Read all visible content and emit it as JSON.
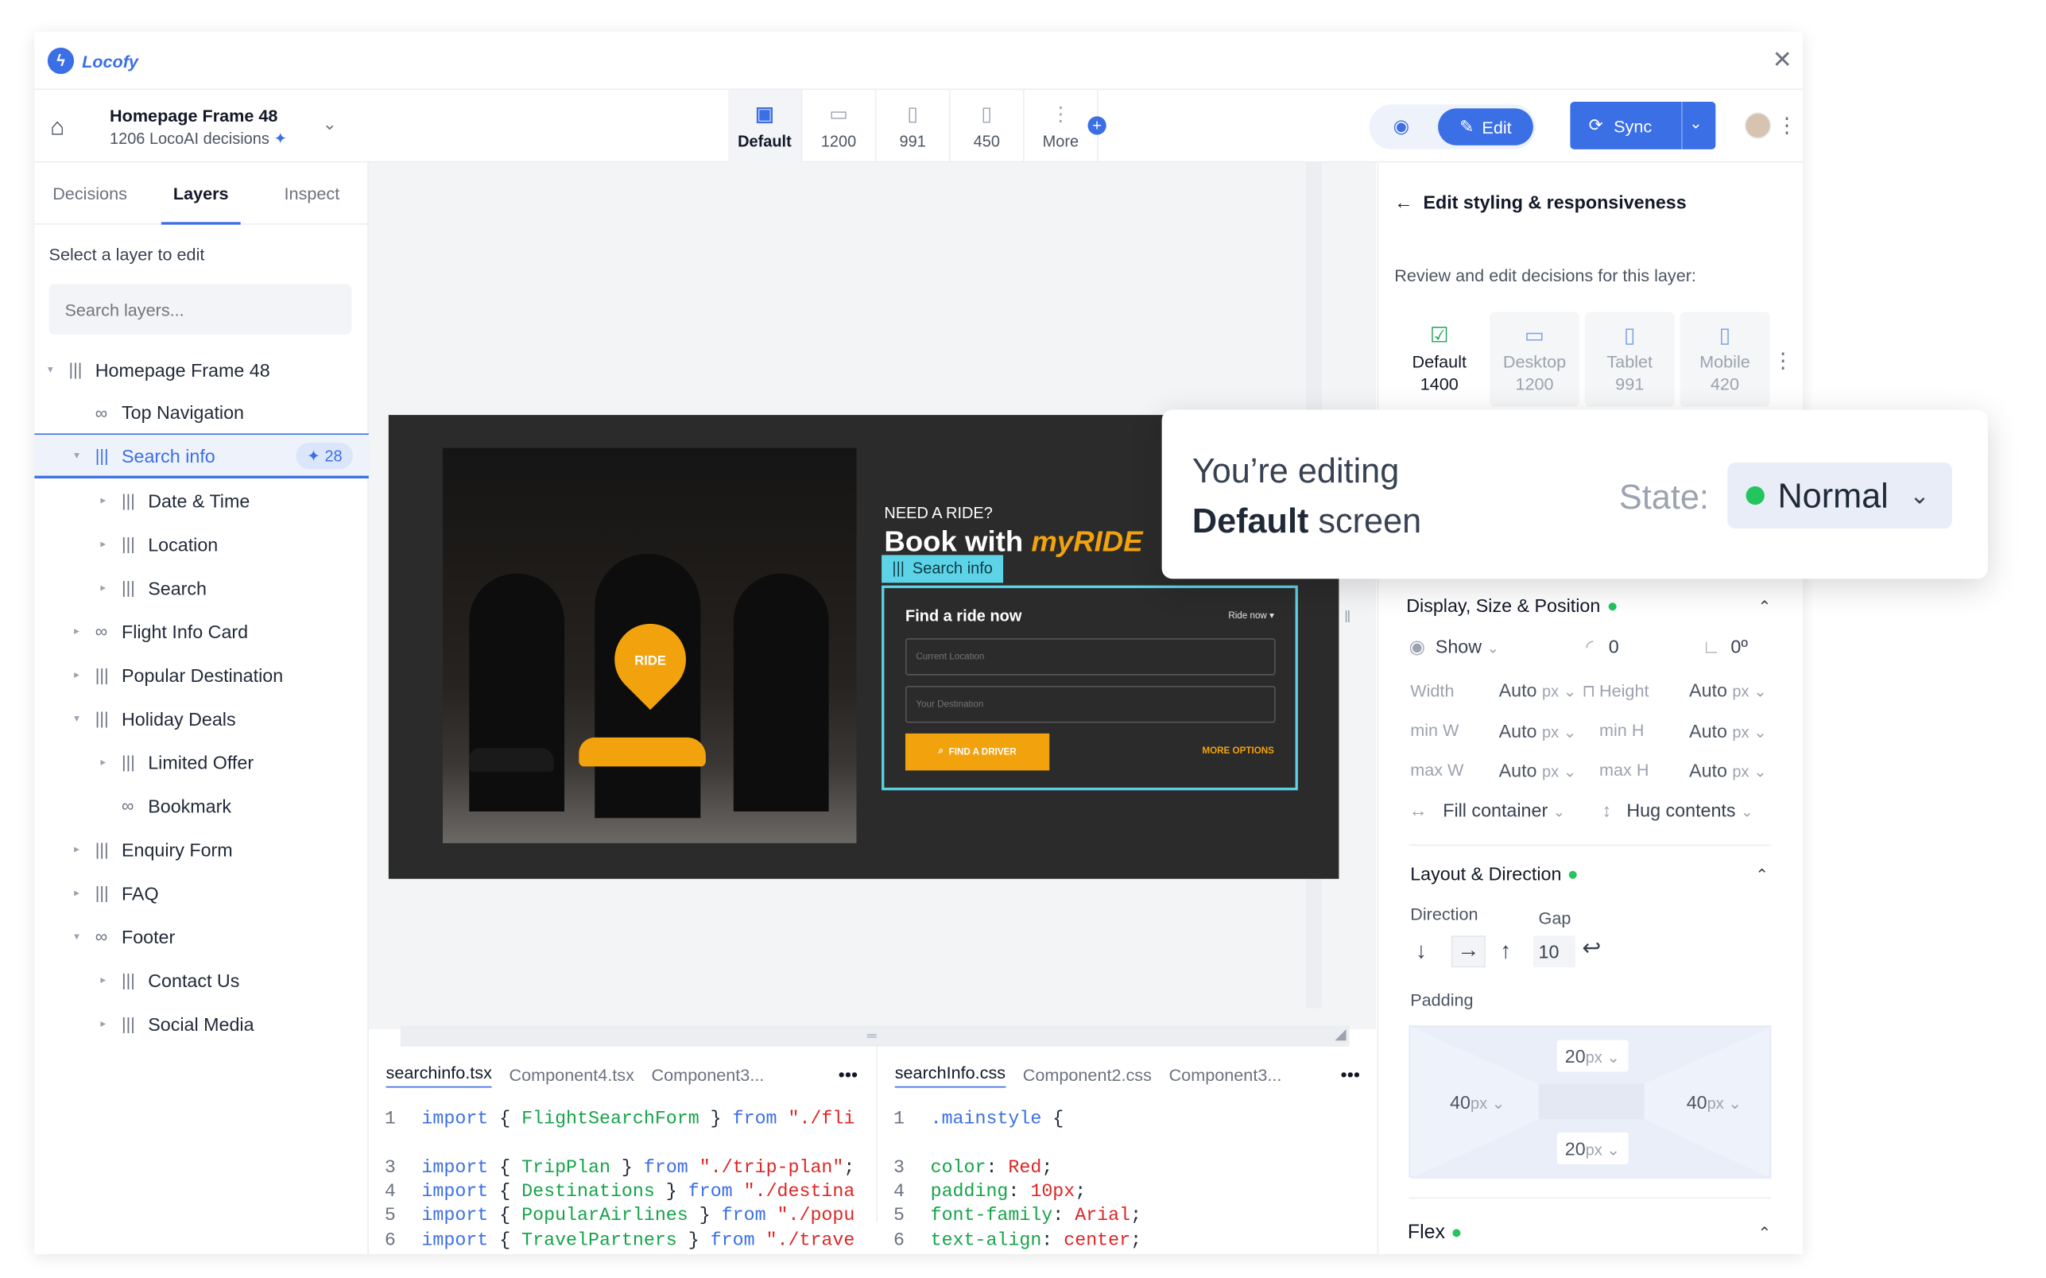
{
  "app": {
    "name": "Locofy",
    "close": "✕"
  },
  "project": {
    "frame": "Homepage Frame 48",
    "decisions": "1206 LocoAI decisions",
    "spark": "✦"
  },
  "breakpoints": [
    {
      "label": "Default",
      "icon": "▣"
    },
    {
      "label": "1200",
      "icon": "▭"
    },
    {
      "label": "991",
      "icon": "▯"
    },
    {
      "label": "450",
      "icon": "▯"
    },
    {
      "label": "More",
      "icon": "⋮"
    }
  ],
  "toolbar": {
    "edit": "Edit",
    "sync": "Sync"
  },
  "left": {
    "tabs": [
      "Decisions",
      "Layers",
      "Inspect"
    ],
    "select_label": "Select a layer to edit",
    "search_placeholder": "Search layers...",
    "tree": [
      {
        "label": "Homepage Frame 48",
        "level": 0,
        "caret": "▾",
        "icon": "bars"
      },
      {
        "label": "Top Navigation",
        "level": 1,
        "caret": "",
        "icon": "link"
      },
      {
        "label": "Search info",
        "level": 1,
        "caret": "▾",
        "icon": "bars",
        "badge": "✦ 28"
      },
      {
        "label": "Date & Time",
        "level": 2,
        "caret": "▸",
        "icon": "bars"
      },
      {
        "label": "Location",
        "level": 2,
        "caret": "▸",
        "icon": "bars"
      },
      {
        "label": "Search",
        "level": 2,
        "caret": "▸",
        "icon": "bars"
      },
      {
        "label": "Flight Info Card",
        "level": 1,
        "caret": "▸",
        "icon": "link"
      },
      {
        "label": "Popular Destination",
        "level": 1,
        "caret": "▸",
        "icon": "bars"
      },
      {
        "label": "Holiday Deals",
        "level": 1,
        "caret": "▾",
        "icon": "bars"
      },
      {
        "label": "Limited Offer",
        "level": 2,
        "caret": "▸",
        "icon": "bars"
      },
      {
        "label": "Bookmark",
        "level": 2,
        "caret": "",
        "icon": "link"
      },
      {
        "label": "Enquiry Form",
        "level": 1,
        "caret": "▸",
        "icon": "bars"
      },
      {
        "label": "FAQ",
        "level": 1,
        "caret": "▸",
        "icon": "bars"
      },
      {
        "label": "Footer",
        "level": 1,
        "caret": "▾",
        "icon": "link"
      },
      {
        "label": "Contact Us",
        "level": 2,
        "caret": "▸",
        "icon": "bars"
      },
      {
        "label": "Social Media",
        "level": 2,
        "caret": "▸",
        "icon": "bars"
      }
    ]
  },
  "preview": {
    "need": "NEED A RIDE?",
    "book_a": "Book with ",
    "book_b": "myRIDE",
    "pin": "RIDE",
    "tag": "Search info",
    "form_title": "Find a ride now",
    "ride_now": "Ride now ▾",
    "current": "Current Location",
    "dest": "Your Destination",
    "find": "FIND A DRIVER",
    "more": "MORE OPTIONS"
  },
  "code_left": {
    "tabs": [
      "searchinfo.tsx",
      "Component4.tsx",
      "Component3..."
    ],
    "more": "•••",
    "lines": [
      {
        "n": "1",
        "y": 0,
        "parts": [
          [
            "kw",
            "import "
          ],
          [
            "pn",
            "{ "
          ],
          [
            "id",
            "FlightSearchForm"
          ],
          [
            "pn",
            " } "
          ],
          [
            "kw",
            "from "
          ],
          [
            "st",
            "\"./fli"
          ]
        ]
      },
      {
        "n": "3",
        "y": 2,
        "parts": [
          [
            "kw",
            "import "
          ],
          [
            "pn",
            "{ "
          ],
          [
            "id",
            "TripPlan"
          ],
          [
            "pn",
            " } "
          ],
          [
            "kw",
            "from "
          ],
          [
            "st",
            "\"./trip-plan\""
          ],
          [
            "pn",
            ";"
          ]
        ]
      },
      {
        "n": "4",
        "y": 3,
        "parts": [
          [
            "kw",
            "import "
          ],
          [
            "pn",
            "{ "
          ],
          [
            "id",
            "Destinations"
          ],
          [
            "pn",
            " } "
          ],
          [
            "kw",
            "from "
          ],
          [
            "st",
            "\"./destina"
          ]
        ]
      },
      {
        "n": "5",
        "y": 4,
        "parts": [
          [
            "kw",
            "import "
          ],
          [
            "pn",
            "{ "
          ],
          [
            "id",
            "PopularAirlines"
          ],
          [
            "pn",
            " } "
          ],
          [
            "kw",
            "from "
          ],
          [
            "st",
            "\"./popu"
          ]
        ]
      },
      {
        "n": "6",
        "y": 5,
        "parts": [
          [
            "kw",
            "import "
          ],
          [
            "pn",
            "{ "
          ],
          [
            "id",
            "TravelPartners"
          ],
          [
            "pn",
            " } "
          ],
          [
            "kw",
            "from "
          ],
          [
            "st",
            "\"./trave"
          ]
        ]
      }
    ]
  },
  "code_right": {
    "tabs": [
      "searchInfo.css",
      "Component2.css",
      "Component3..."
    ],
    "more": "•••",
    "lines": [
      {
        "n": "1",
        "y": 0,
        "parts": [
          [
            "kw",
            ".mainstyle "
          ],
          [
            "pn",
            "{"
          ]
        ]
      },
      {
        "n": "3",
        "y": 2,
        "parts": [
          [
            "id",
            "  color"
          ],
          [
            "pn",
            ": "
          ],
          [
            "st",
            "Red"
          ],
          [
            "pn",
            ";"
          ]
        ]
      },
      {
        "n": "4",
        "y": 3,
        "parts": [
          [
            "id",
            "  padding"
          ],
          [
            "pn",
            ": "
          ],
          [
            "st",
            "10px"
          ],
          [
            "pn",
            ";"
          ]
        ]
      },
      {
        "n": "5",
        "y": 4,
        "parts": [
          [
            "id",
            "  font-family"
          ],
          [
            "pn",
            ": "
          ],
          [
            "st",
            "Arial"
          ],
          [
            "pn",
            ";"
          ]
        ]
      },
      {
        "n": "6",
        "y": 5,
        "parts": [
          [
            "id",
            "  text-align"
          ],
          [
            "pn",
            ": "
          ],
          [
            "st",
            "center"
          ],
          [
            "pn",
            ";"
          ]
        ]
      }
    ]
  },
  "right": {
    "title": "Edit styling & responsiveness",
    "subtitle": "Review and edit decisions for this layer:",
    "bps": [
      {
        "name": "Default",
        "w": "1400",
        "icon": "☑"
      },
      {
        "name": "Desktop",
        "w": "1200",
        "icon": "▭"
      },
      {
        "name": "Tablet",
        "w": "991",
        "icon": "▯"
      },
      {
        "name": "Mobile",
        "w": "420",
        "icon": "▯"
      }
    ],
    "display": {
      "title": "Display, Size & Position",
      "show": "Show",
      "radius": "0",
      "angle": "0º",
      "width_l": "Width",
      "width_v": "Auto",
      "height_l": "Height",
      "height_v": "Auto",
      "minw_l": "min W",
      "minw_v": "Auto",
      "minh_l": "min H",
      "minh_v": "Auto",
      "maxw_l": "max W",
      "maxw_v": "Auto",
      "maxh_l": "max H",
      "maxh_v": "Auto",
      "unit": "px",
      "fill": "Fill container",
      "hug": "Hug contents"
    },
    "layout": {
      "title": "Layout & Direction",
      "direction": "Direction",
      "gap": "Gap",
      "gap_v": "10",
      "padding": "Padding"
    },
    "padding": {
      "top": "20",
      "bottom": "20",
      "left": "40",
      "right": "40",
      "unit": "px"
    },
    "flex": {
      "title": "Flex"
    }
  },
  "overlay": {
    "line1": "You’re editing",
    "line2_b": "Default",
    "line2": " screen",
    "state": "State:",
    "value": "Normal"
  }
}
